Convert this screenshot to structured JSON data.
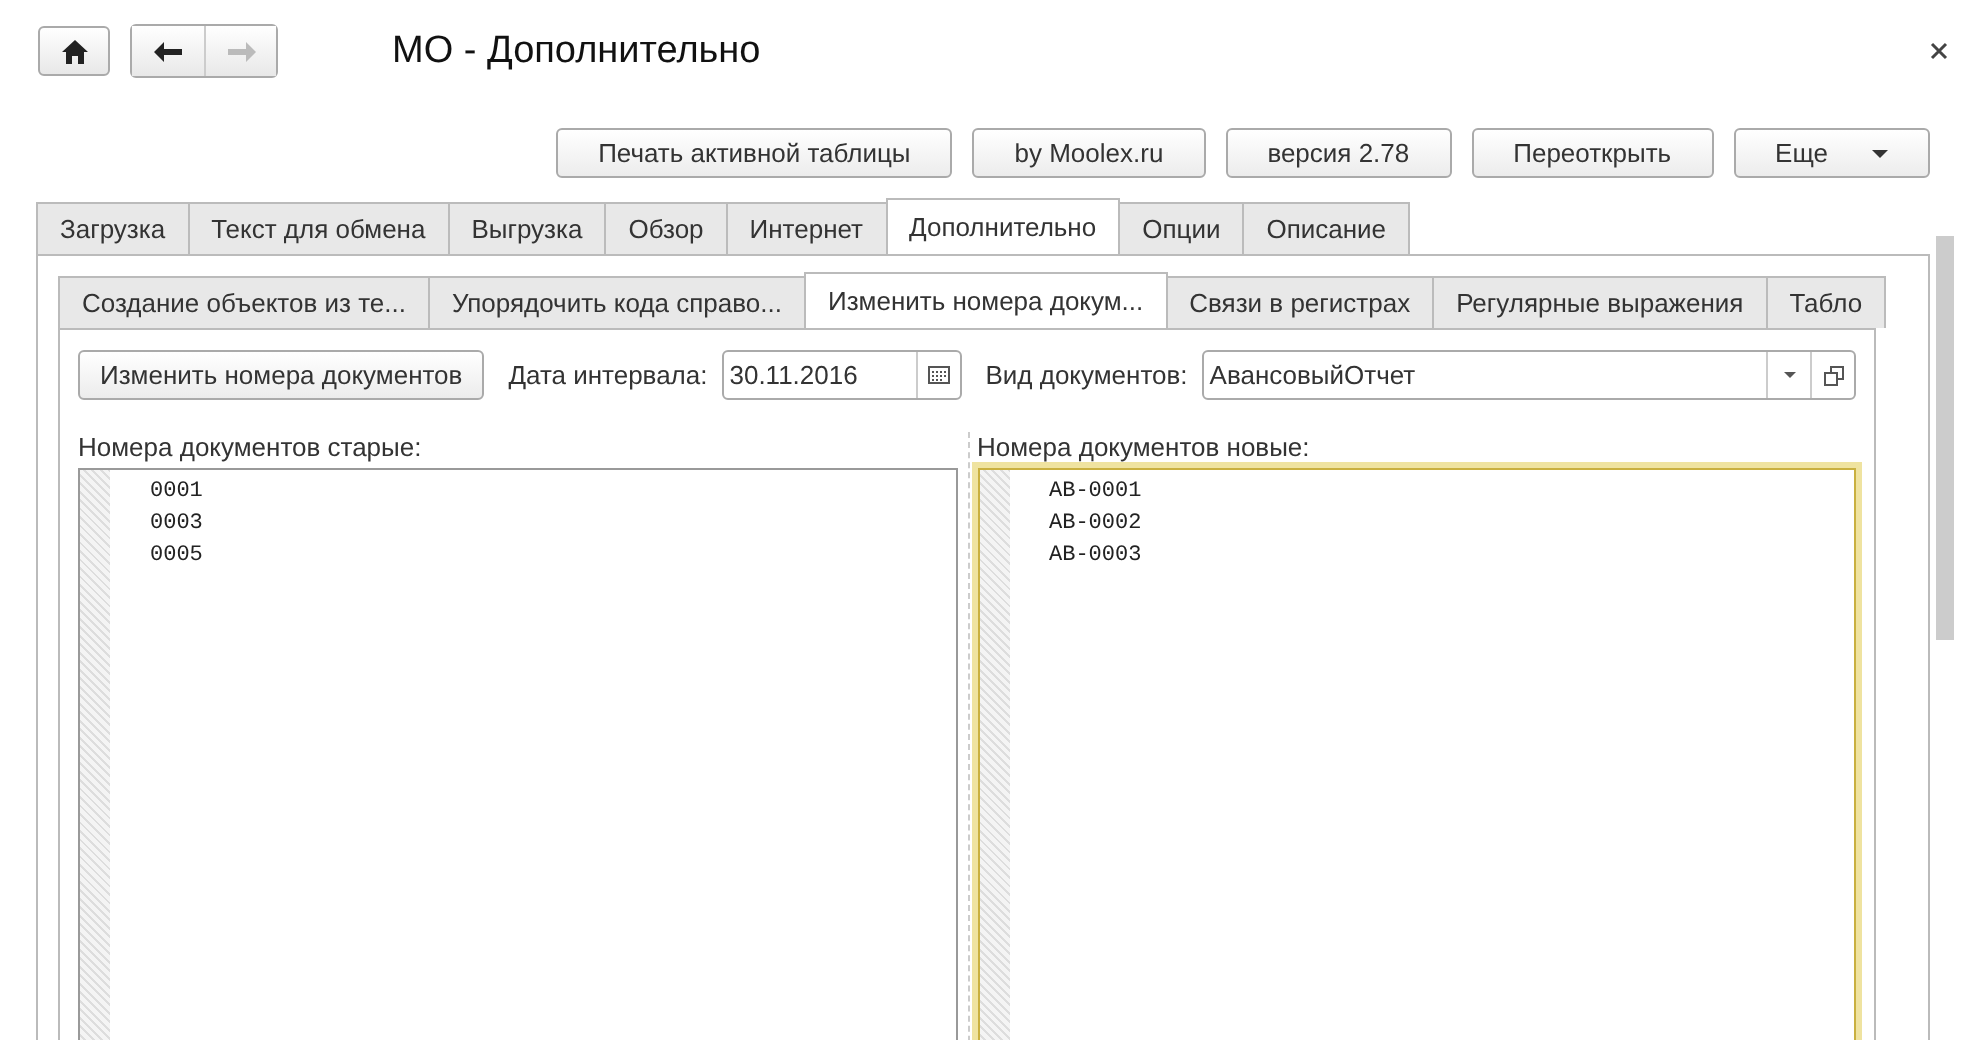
{
  "window": {
    "title": "МО - Дополнительно"
  },
  "nav": {
    "back_enabled": true,
    "forward_enabled": false
  },
  "toolbar": {
    "buttons": [
      {
        "label": "Печать активной таблицы",
        "kind": "button"
      },
      {
        "label": "by Moolex.ru",
        "kind": "button"
      },
      {
        "label": "версия 2.78",
        "kind": "button"
      },
      {
        "label": "Переоткрыть",
        "kind": "button"
      },
      {
        "label": "Еще",
        "kind": "menu"
      }
    ]
  },
  "tabs": [
    {
      "label": "Загрузка",
      "selected": false
    },
    {
      "label": "Текст для обмена",
      "selected": false
    },
    {
      "label": "Выгрузка",
      "selected": false
    },
    {
      "label": "Обзор",
      "selected": false
    },
    {
      "label": "Интернет",
      "selected": false
    },
    {
      "label": "Дополнительно",
      "selected": true
    },
    {
      "label": "Опции",
      "selected": false
    },
    {
      "label": "Описание",
      "selected": false
    }
  ],
  "subtabs": [
    {
      "label": "Создание объектов из те...",
      "selected": false
    },
    {
      "label": "Упорядочить кода справо...",
      "selected": false
    },
    {
      "label": "Изменить номера докум...",
      "selected": true
    },
    {
      "label": "Связи в регистрах",
      "selected": false
    },
    {
      "label": "Регулярные выражения",
      "selected": false
    },
    {
      "label": "Табло",
      "selected": false
    }
  ],
  "form": {
    "action_button": "Изменить номера документов",
    "date_label": "Дата интервала:",
    "date_value": "30.11.2016",
    "kind_label": "Вид документов:",
    "kind_value": "АвансовыйОтчет"
  },
  "editors": [
    {
      "label": "Номера документов старые:",
      "focused": false,
      "lines": [
        "0001",
        "0003",
        "0005"
      ]
    },
    {
      "label": "Номера документов новые:",
      "focused": true,
      "lines": [
        "АВ-0001",
        "АВ-0002",
        "АВ-0003"
      ]
    }
  ]
}
